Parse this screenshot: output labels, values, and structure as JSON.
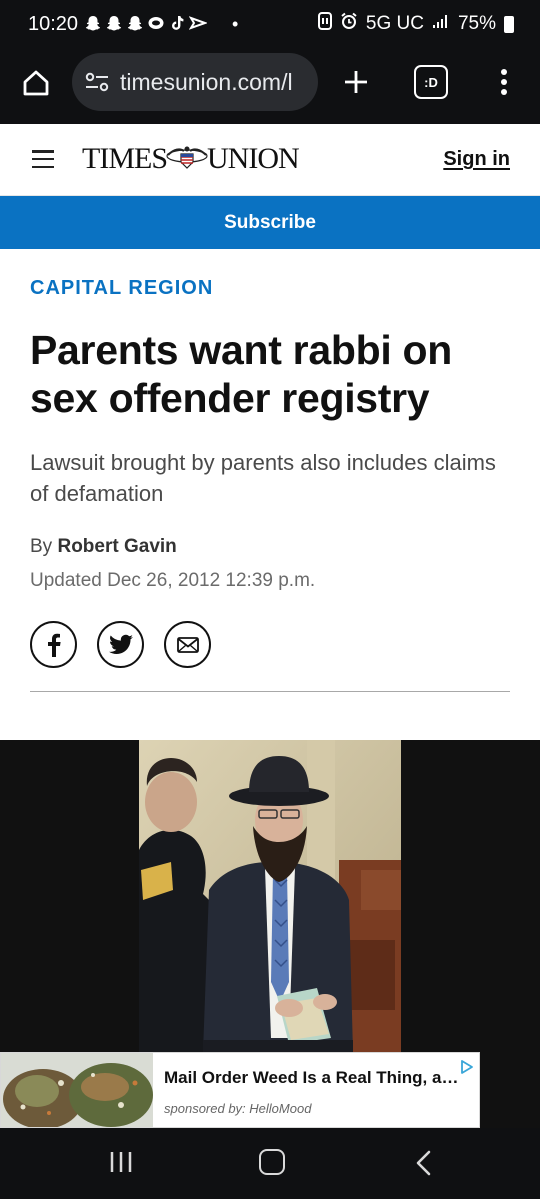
{
  "status_bar": {
    "time": "10:20",
    "network": "5G UC",
    "battery": "75%",
    "notification_icons": [
      "snapchat-icon",
      "snapchat-icon",
      "snapchat-icon",
      "chat-bubble-icon",
      "tiktok-icon",
      "capcut-icon"
    ]
  },
  "browser": {
    "url": "timesunion.com/l",
    "tab_count": ":D"
  },
  "site": {
    "logo_left": "TIMES",
    "logo_right": "UNION",
    "signin": "Sign in",
    "subscribe": "Subscribe"
  },
  "article": {
    "section": "CAPITAL REGION",
    "headline": "Parents want rabbi on sex offender registry",
    "subhead": "Lawsuit brought by parents also includes claims of defamation",
    "byline_prefix": "By",
    "author": "Robert Gavin",
    "updated": "Updated Dec 26, 2012 12:39 p.m."
  },
  "share": [
    "facebook-icon",
    "twitter-icon",
    "email-icon"
  ],
  "ad": {
    "title": "Mail Order Weed Is a Real Thing, and...",
    "sponsor": "sponsored by: HelloMood"
  },
  "colors": {
    "accent": "#0a72c2",
    "system_bar": "#0f1012",
    "url_pill": "#2a2c30"
  }
}
